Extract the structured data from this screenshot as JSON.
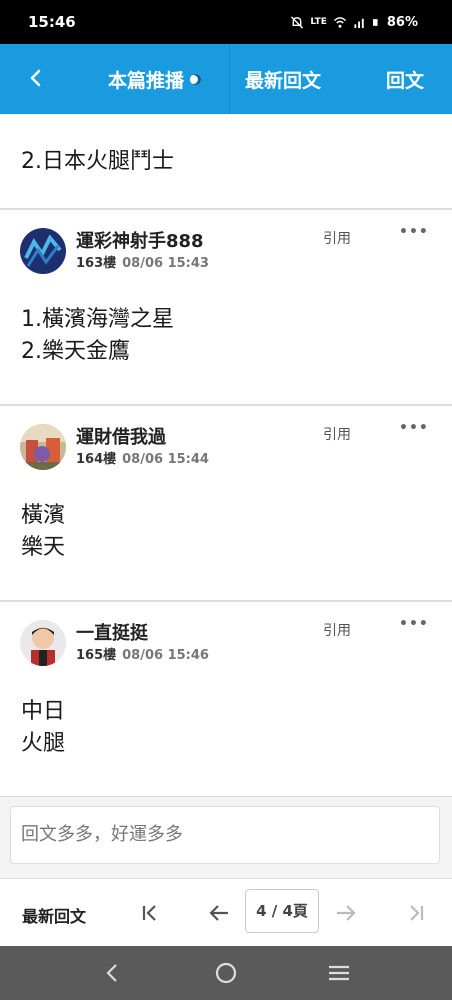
{
  "status": {
    "time": "15:46",
    "battery": "86%"
  },
  "nav": {
    "broadcast": "本篇推播",
    "latest": "最新回文",
    "reply": "回文"
  },
  "first_post": {
    "text": "2.日本火腿鬥士"
  },
  "posts": [
    {
      "username": "運彩神射手888",
      "floor": "163樓",
      "time": "08/06 15:43",
      "quote": "引用",
      "more": "•••",
      "lines": [
        "1.橫濱海灣之星",
        "2.樂天金鷹"
      ]
    },
    {
      "username": "運財借我過",
      "floor": "164樓",
      "time": "08/06 15:44",
      "quote": "引用",
      "more": "•••",
      "lines": [
        "橫濱",
        "樂天"
      ]
    },
    {
      "username": "一直挺挺",
      "floor": "165樓",
      "time": "08/06 15:46",
      "quote": "引用",
      "more": "•••",
      "lines": [
        "中日",
        "火腿"
      ]
    }
  ],
  "reply_input": {
    "placeholder": "回文多多，好運多多"
  },
  "pager": {
    "latest": "最新回文",
    "page": "4 / 4頁"
  },
  "icons": [
    "back-icon",
    "first-page-icon",
    "prev-page-icon",
    "next-page-icon",
    "last-page-icon",
    "sys-back-icon",
    "sys-home-icon",
    "sys-recents-icon"
  ],
  "colors": {
    "accent": "#1a9be0"
  }
}
